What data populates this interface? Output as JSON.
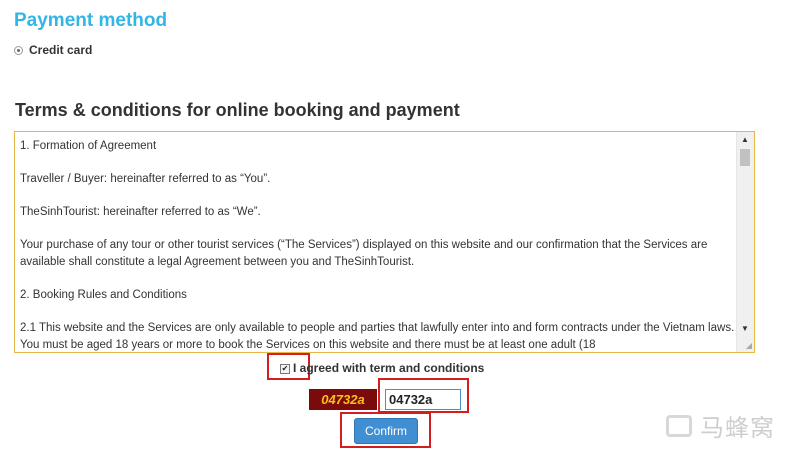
{
  "payment": {
    "title": "Payment method",
    "option_label": "Credit card"
  },
  "terms": {
    "title": "Terms & conditions for online booking and payment",
    "paragraphs": [
      "1. Formation of Agreement",
      "Traveller / Buyer: hereinafter referred to as “You”.",
      "TheSinhTourist: hereinafter referred to as “We”.",
      "Your purchase of any tour or other tourist services (“The Services”) displayed on this website and our confirmation that the Services are available shall constitute a legal Agreement between you and TheSinhTourist.",
      "2. Booking Rules and Conditions",
      "2.1 This website and the Services are only available to people and parties that lawfully enter into and form contracts under the Vietnam laws. You must be aged 18 years or more to book the Services on this website and there must be at least one adult (18"
    ]
  },
  "agree": {
    "label": "I agreed with term and conditions",
    "checked": true
  },
  "captcha": {
    "code": "04732a",
    "input_value": "04732a"
  },
  "confirm": {
    "label": "Confirm"
  },
  "colors": {
    "accent": "#33b5e5",
    "button": "#3f8fd2",
    "highlight": "#d21e1e",
    "captcha_bg": "#7b0a0a",
    "captcha_fg": "#f7c21b"
  },
  "watermark": {
    "text": "马蜂窝",
    "icon": "mafengwo-logo-icon"
  }
}
